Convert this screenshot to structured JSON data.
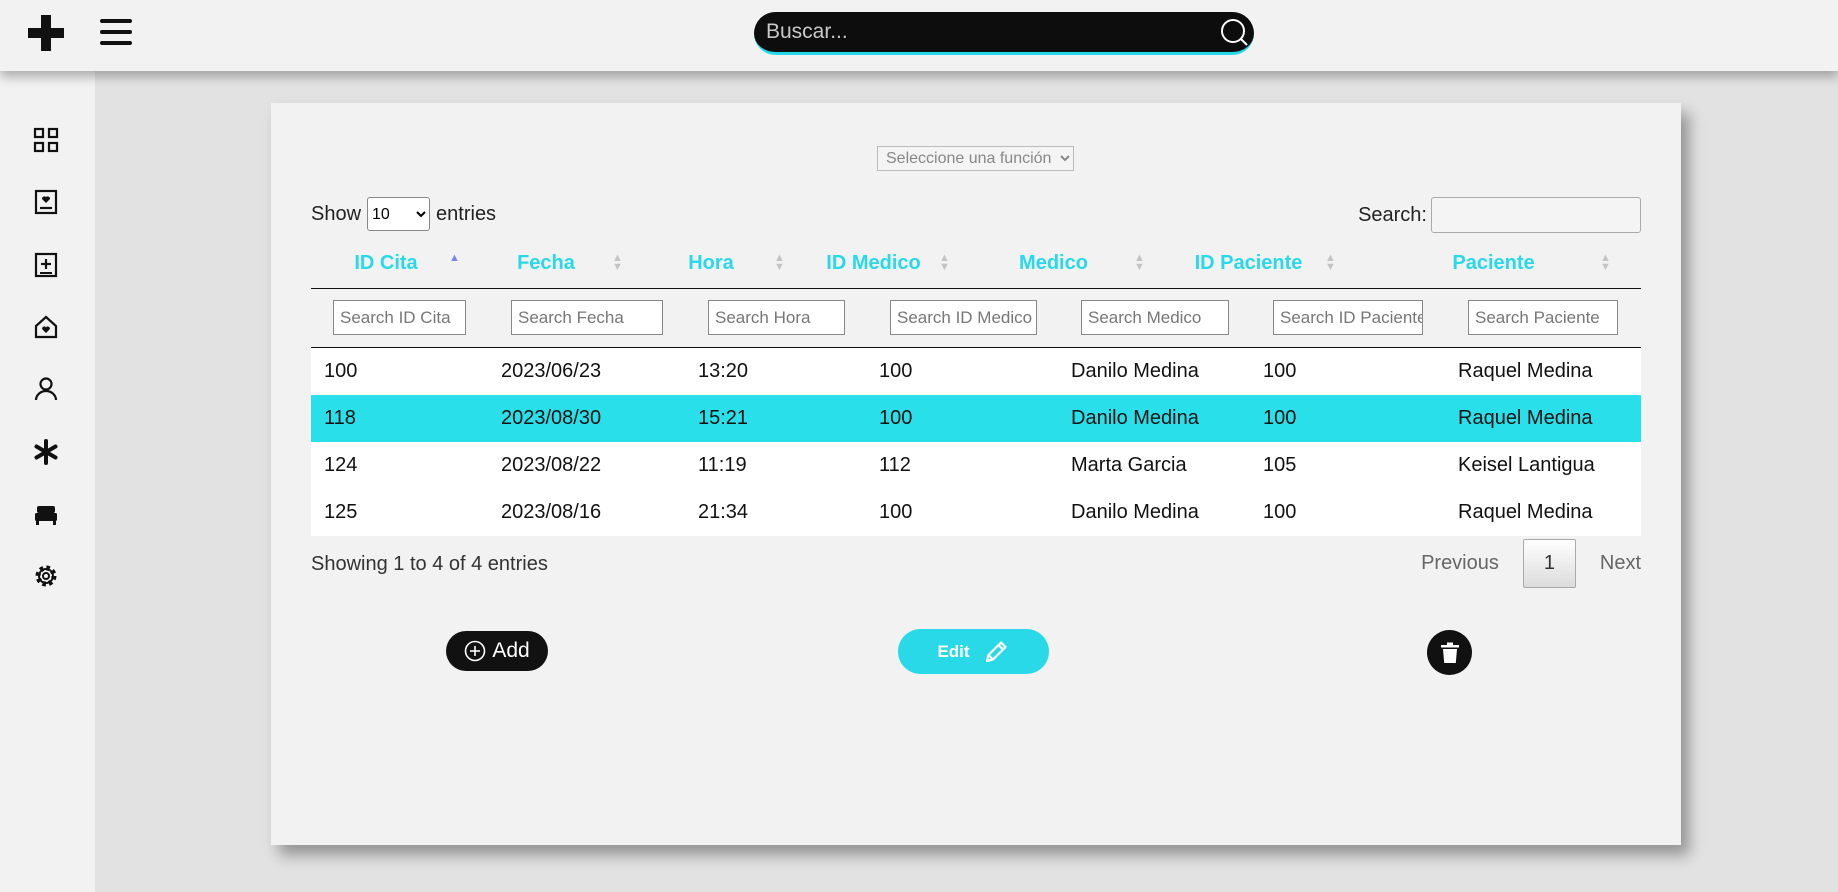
{
  "header": {
    "search_placeholder": "Buscar..."
  },
  "card": {
    "function_select": {
      "selected": "Seleccione una función"
    },
    "show_label": "Show",
    "entries_select": "10",
    "entries_label": "entries",
    "search_label": "Search:",
    "columns": [
      "ID Cita",
      "Fecha",
      "Hora",
      "ID Medico",
      "Medico",
      "ID Paciente",
      "Paciente"
    ],
    "filters": [
      "Search ID Cita",
      "Search Fecha",
      "Search Hora",
      "Search ID Medico",
      "Search Medico",
      "Search ID Paciente",
      "Search Paciente"
    ],
    "rows": [
      [
        "100",
        "2023/06/23",
        "13:20",
        "100",
        "Danilo Medina",
        "100",
        "Raquel Medina"
      ],
      [
        "118",
        "2023/08/30",
        "15:21",
        "100",
        "Danilo Medina",
        "100",
        "Raquel Medina"
      ],
      [
        "124",
        "2023/08/22",
        "11:19",
        "112",
        "Marta Garcia",
        "105",
        "Keisel Lantigua"
      ],
      [
        "125",
        "2023/08/16",
        "21:34",
        "100",
        "Danilo Medina",
        "100",
        "Raquel Medina"
      ]
    ],
    "selected_row": 1,
    "info": "Showing 1 to 4 of 4 entries",
    "pagination": {
      "previous": "Previous",
      "page": "1",
      "next": "Next"
    },
    "buttons": {
      "add": "Add",
      "edit": "Edit"
    }
  },
  "colors": {
    "accent": "#29d9e8",
    "dark": "#111111",
    "background": "#e2e2e2",
    "panel": "#f2f2f2"
  },
  "sidebar_icons": [
    "dashboard-icon",
    "patient-card-icon",
    "medical-add-icon",
    "clinic-home-icon",
    "user-icon",
    "asterisk-icon",
    "bed-icon",
    "settings-icon"
  ]
}
